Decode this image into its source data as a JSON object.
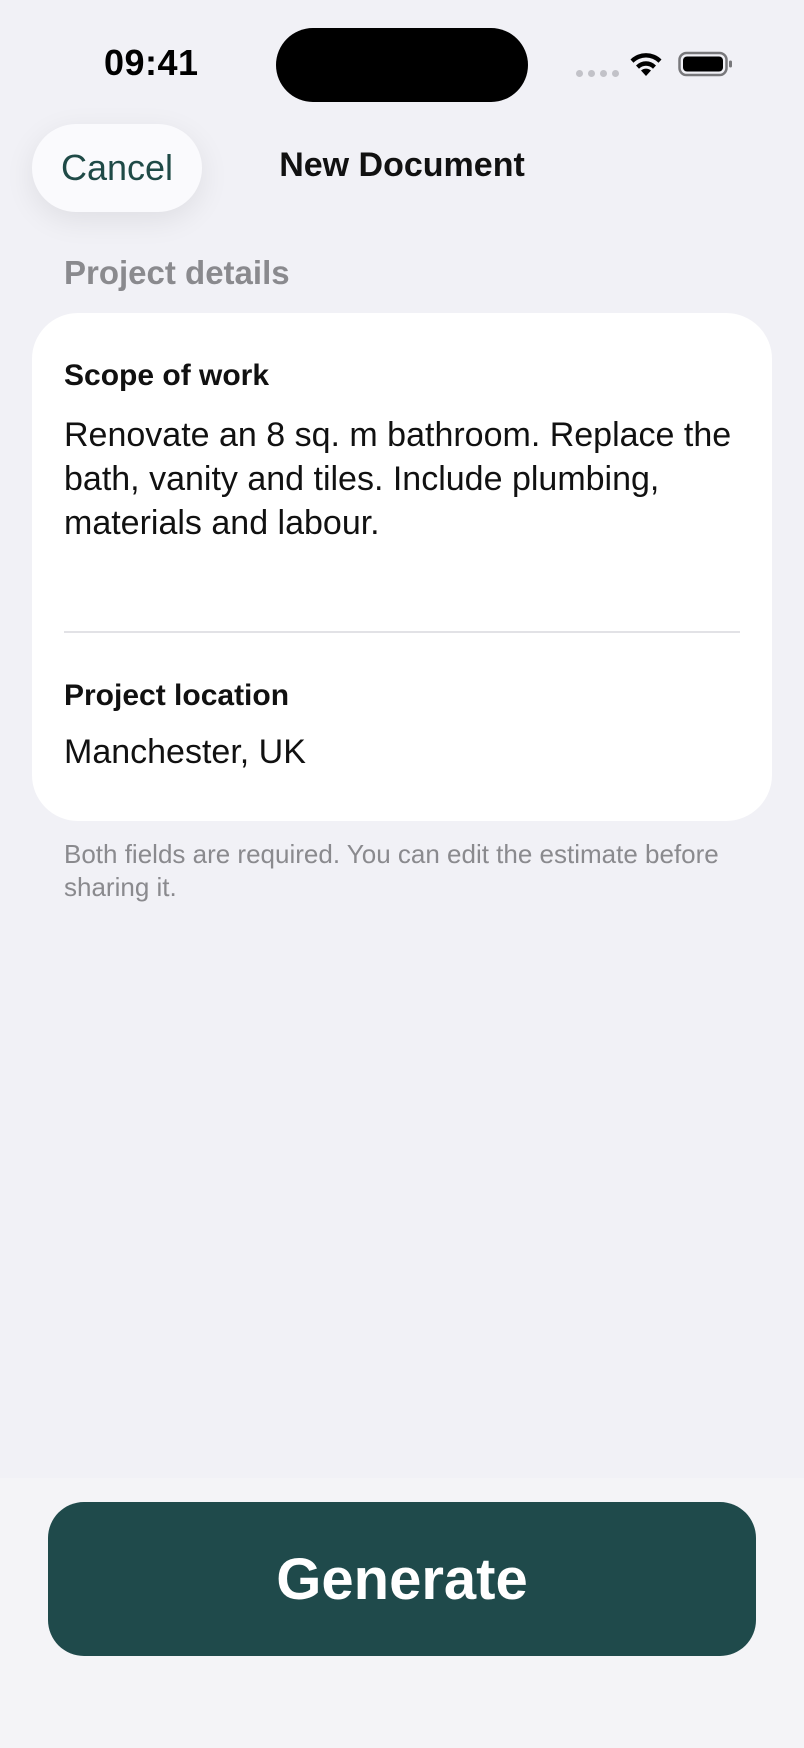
{
  "status_bar": {
    "time": "09:41",
    "icons": [
      "cellular-signal-icon",
      "wifi-icon",
      "battery-icon"
    ]
  },
  "nav": {
    "cancel_label": "Cancel",
    "title": "New Document"
  },
  "form": {
    "section_header": "Project details",
    "scope": {
      "label": "Scope of work",
      "value": "Renovate an 8 sq. m bathroom. Replace the bath, vanity and tiles. Include plumbing, materials and labour."
    },
    "location": {
      "label": "Project location",
      "value": "Manchester, UK"
    },
    "footer_note": "Both fields are required. You can edit the estimate before sharing it."
  },
  "actions": {
    "generate_label": "Generate"
  },
  "colors": {
    "background": "#f1f1f6",
    "accent": "#1f4a4b",
    "secondary_text": "#8a8a8e"
  }
}
